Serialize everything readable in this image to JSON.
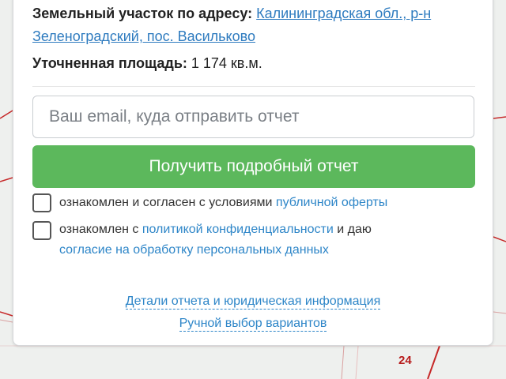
{
  "map": {
    "label": "24"
  },
  "card": {
    "address_label": "Земельный участок по адресу:",
    "address_link": "Калининградская обл., р-н Зеленоградский, пос. Васильково",
    "area_label": "Уточненная площадь:",
    "area_value": " 1 174 кв.м.",
    "email_placeholder": "Ваш email, куда отправить отчет",
    "email_value": "",
    "submit_label": "Получить подробный отчет",
    "consent1_text": "ознакомлен и согласен с условиями ",
    "consent1_link": "публичной оферты",
    "consent1_checked": false,
    "consent2_text_a": "ознакомлен с ",
    "consent2_link_a": "политикой конфиденциальности",
    "consent2_text_b": " и даю ",
    "consent2_link_b": "согласие на обработку персональных данных",
    "consent2_checked": false,
    "details_link": "Детали отчета и юридическая информация",
    "manual_link": "Ручной выбор вариантов"
  },
  "colors": {
    "button_green": "#5cb85c",
    "link_blue": "#2e86c8",
    "map_line_red": "#c62828"
  }
}
